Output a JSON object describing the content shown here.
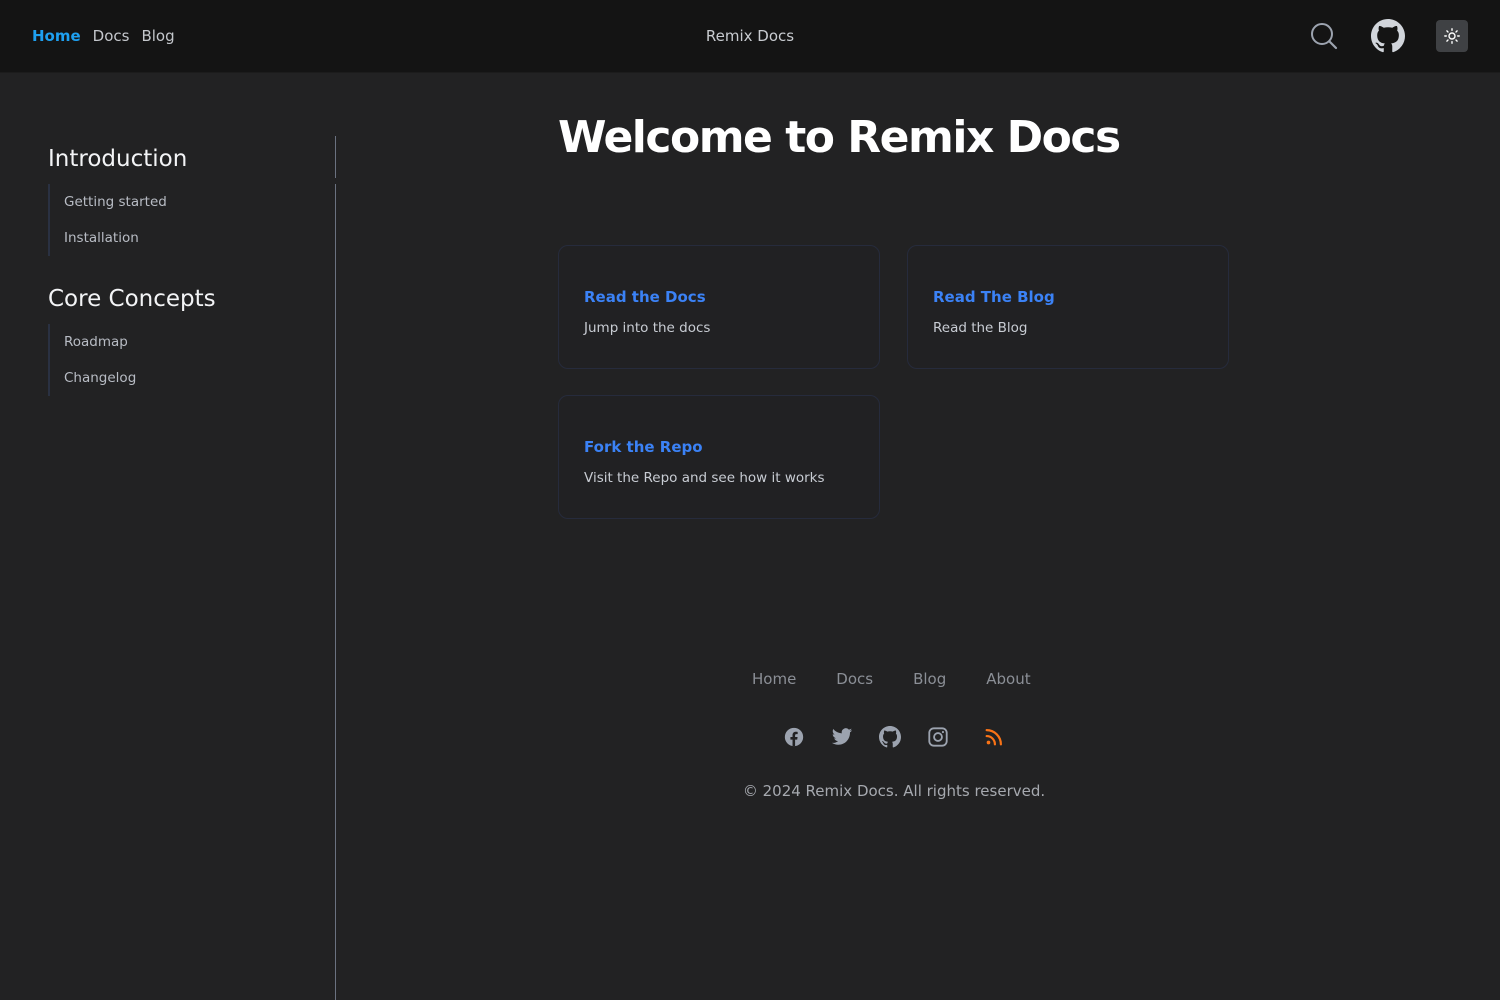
{
  "topbar": {
    "nav": [
      "Home",
      "Docs",
      "Blog"
    ],
    "brand": "Remix Docs",
    "icons": {
      "search": "search-icon",
      "github": "github-icon",
      "theme": "sun-icon"
    }
  },
  "sidebar": {
    "sections": [
      {
        "title": "Introduction",
        "items": [
          "Getting started",
          "Installation"
        ]
      },
      {
        "title": "Core Concepts",
        "items": [
          "Roadmap",
          "Changelog"
        ]
      }
    ]
  },
  "main": {
    "title": "Welcome to Remix Docs",
    "cards": [
      {
        "title": "Read the Docs",
        "description": "Jump into the docs"
      },
      {
        "title": "Read The Blog",
        "description": "Read the Blog"
      },
      {
        "title": "Fork the Repo",
        "description": "Visit the Repo and see how it works"
      }
    ]
  },
  "footer": {
    "links": [
      "Home",
      "Docs",
      "Blog",
      "About"
    ],
    "social_icons": [
      "facebook-icon",
      "twitter-icon",
      "github-icon",
      "instagram-icon",
      "rss-icon"
    ],
    "copyright": "© 2024 Remix Docs. All rights reserved."
  },
  "colors": {
    "background": "#222223",
    "topbar": "#141414",
    "accent": "#1ea0f0",
    "link": "#3b82f6",
    "rss": "#f97316"
  }
}
